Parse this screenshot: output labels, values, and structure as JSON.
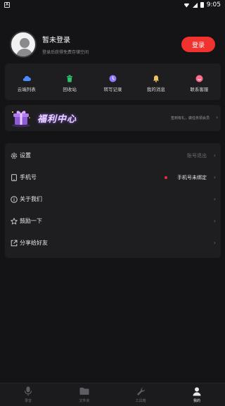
{
  "status_bar": {
    "time": "9:05"
  },
  "profile": {
    "name": "暂未登录",
    "subtitle": "登录后获得免费存储空间",
    "login_label": "登录"
  },
  "quick_actions": [
    {
      "label": "云端列表",
      "icon": "cloud-icon",
      "color": "#4a8cff"
    },
    {
      "label": "回收站",
      "icon": "trash-icon",
      "color": "#2fbf71"
    },
    {
      "label": "转写记录",
      "icon": "clock-icon",
      "color": "#8c7bff"
    },
    {
      "label": "我的消息",
      "icon": "bell-icon",
      "color": "#f0c060"
    },
    {
      "label": "联系客服",
      "icon": "support-icon",
      "color": "#ff6b8a"
    }
  ],
  "welfare": {
    "title": "福利中心",
    "subtitle": "签到有礼，做任务领会员"
  },
  "settings": [
    {
      "label": "设置",
      "value": "账号退出",
      "icon": "gear-icon"
    },
    {
      "label": "手机号",
      "value": "手机号未绑定",
      "icon": "phone-icon"
    },
    {
      "label": "关于我们",
      "value": "",
      "icon": "info-icon"
    },
    {
      "label": "鼓励一下",
      "value": "",
      "icon": "star-icon"
    },
    {
      "label": "分享给好友",
      "value": "",
      "icon": "share-icon"
    }
  ],
  "tabs": [
    {
      "label": "录音",
      "icon": "mic-icon",
      "active": false
    },
    {
      "label": "文件夹",
      "icon": "folder-icon",
      "active": false
    },
    {
      "label": "工具箱",
      "icon": "wrench-icon",
      "active": false
    },
    {
      "label": "我的",
      "icon": "person-icon",
      "active": true
    }
  ]
}
